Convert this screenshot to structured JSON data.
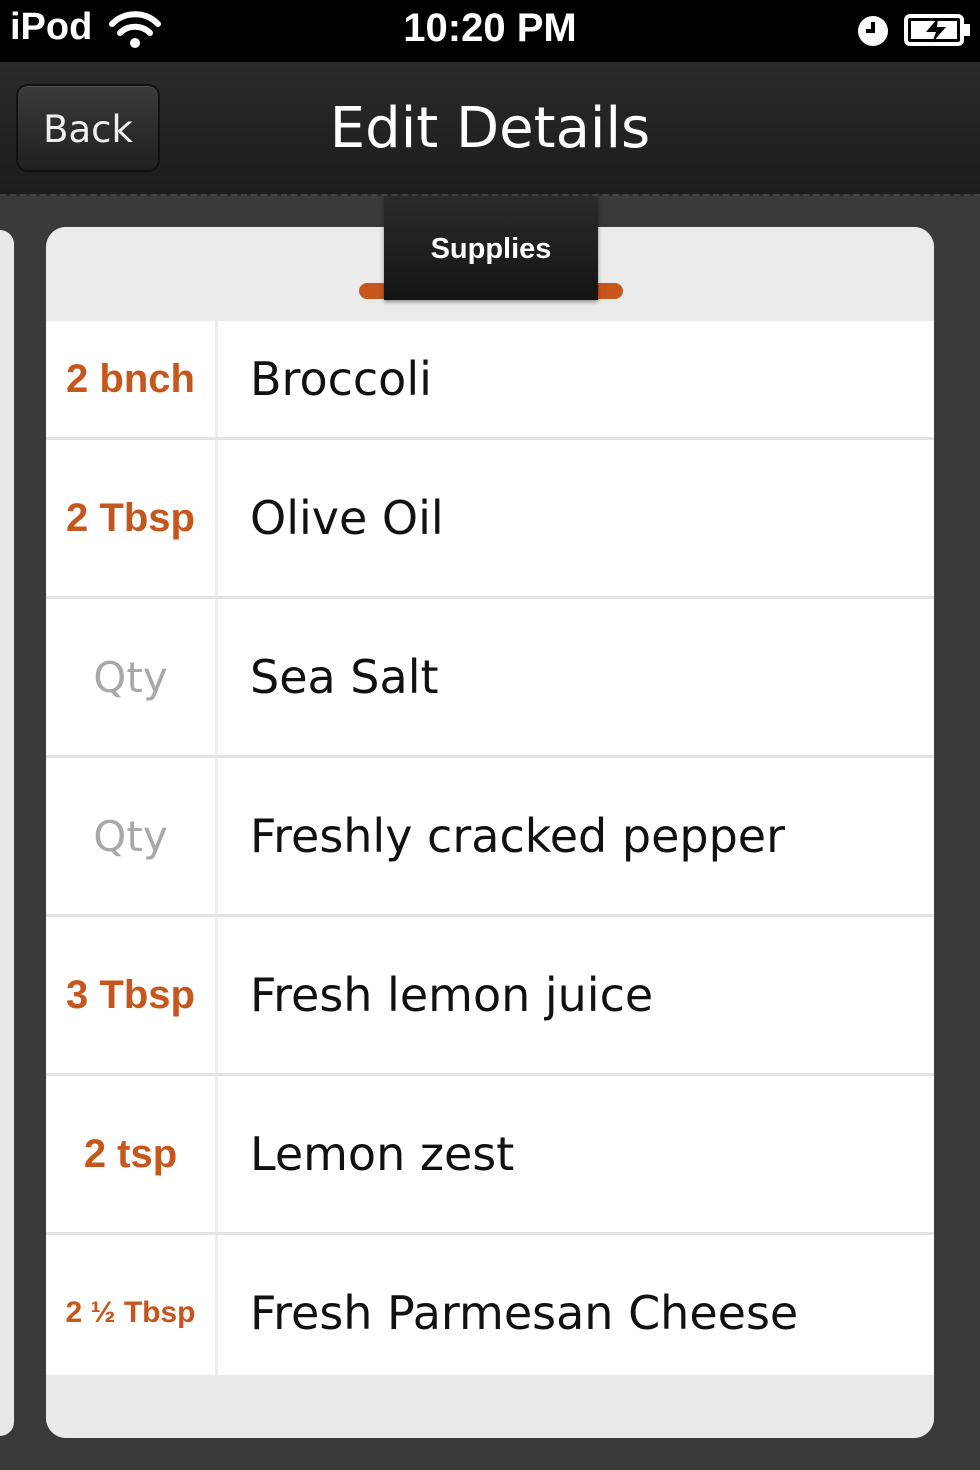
{
  "status_bar": {
    "carrier": "iPod",
    "time": "10:20 PM",
    "icons": [
      "wifi-icon",
      "alarm-clock-icon",
      "battery-charging-icon"
    ]
  },
  "nav": {
    "back_label": "Back",
    "title": "Edit Details"
  },
  "tab": {
    "label": "Supplies"
  },
  "colors": {
    "accent": "#c7561c",
    "placeholder": "#a8a8a8",
    "nav_background": "#1f1f1f"
  },
  "supplies": [
    {
      "qty": "2 bnch",
      "name": "Broccoli"
    },
    {
      "qty": "2 Tbsp",
      "name": "Olive Oil"
    },
    {
      "qty": "Qty",
      "name": "Sea Salt"
    },
    {
      "qty": "Qty",
      "name": "Freshly cracked pepper"
    },
    {
      "qty": "3 Tbsp",
      "name": "Fresh lemon juice"
    },
    {
      "qty": "2 tsp",
      "name": "Lemon zest"
    },
    {
      "qty": "2 ½ Tbsp",
      "name": "Fresh Parmesan Cheese"
    }
  ]
}
